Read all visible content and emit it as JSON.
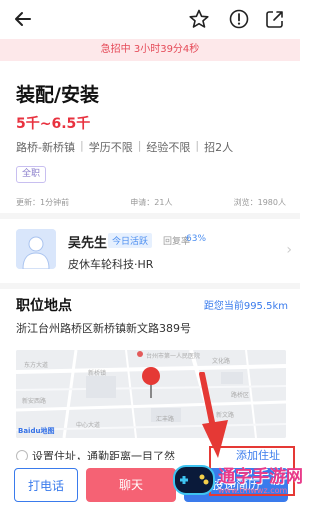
{
  "urgent_banner": "急招中 3小时39分4秒",
  "job": {
    "title": "装配/安装",
    "salary": "5千~6.5千",
    "tags": [
      "路桥-新桥镇",
      "学历不限",
      "经验不限",
      "招2人"
    ],
    "type_badge": "全职"
  },
  "meta": {
    "updated": "更新：1分钟前",
    "applicants": "申请：21人",
    "views": "浏览：1980人"
  },
  "hr": {
    "name": "吴先生",
    "active": "今日活跃",
    "reply_label": "回复率",
    "reply_rate": "63%",
    "company": "皮休车轮科技·HR"
  },
  "location": {
    "title": "职位地点",
    "distance": "距您当前995.5km",
    "address": "浙江台州路桥区新桥镇新文路389号"
  },
  "map": {
    "labels": [
      "台州市第一人民医院",
      "东方大道",
      "新桥镇",
      "文化路",
      "新安西路",
      "路桥区",
      "汇丰路",
      "中心大道",
      "新文路"
    ],
    "logo": "Baidu地图"
  },
  "hint": {
    "text": "设置住址，通勤距离一目了然",
    "action": "添加住址"
  },
  "actions": {
    "call": "打电话",
    "chat": "聊天",
    "apply": "投递简历"
  },
  "watermark": {
    "text": "通字手游网",
    "url": "www.tmwwz.com"
  },
  "colors": {
    "accent_blue": "#3a7bec",
    "accent_red": "#e8323f",
    "chat_pink": "#f56274"
  }
}
